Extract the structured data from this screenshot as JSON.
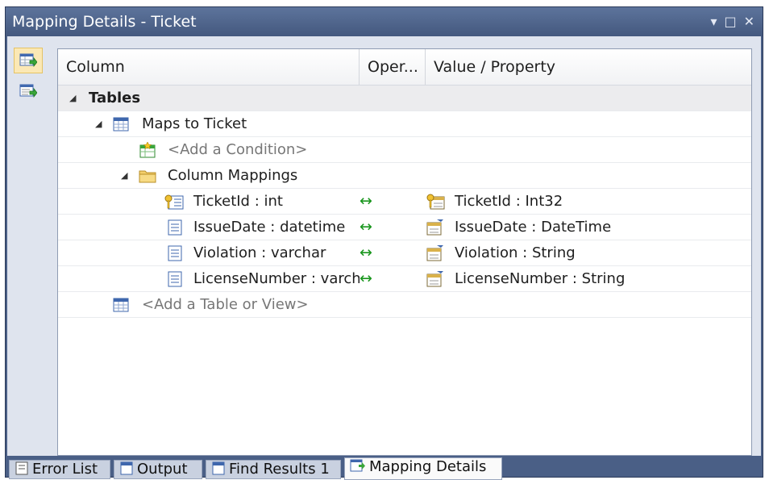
{
  "window": {
    "title": "Mapping Details - Ticket",
    "controls": {
      "dropdown": "▾",
      "maximize": "□",
      "close": "✕"
    }
  },
  "sidebar": {
    "buttons": [
      {
        "icon": "map-to-table-icon",
        "active": true
      },
      {
        "icon": "map-to-function-icon",
        "active": false
      }
    ]
  },
  "grid": {
    "headers": {
      "column": "Column",
      "operator": "Oper...",
      "value": "Value / Property"
    },
    "rows": [
      {
        "label": "Tables"
      },
      {
        "label": "Maps to Ticket"
      },
      {
        "label": "<Add a Condition>"
      },
      {
        "label": "Column Mappings"
      },
      {
        "column": "TicketId : int",
        "op": "↔",
        "property": "TicketId : Int32"
      },
      {
        "column": "IssueDate : datetime",
        "op": "↔",
        "property": "IssueDate : DateTime"
      },
      {
        "column": "Violation : varchar",
        "op": "↔",
        "property": "Violation : String"
      },
      {
        "column": "LicenseNumber : varch",
        "op": "↔",
        "property": "LicenseNumber : String"
      },
      {
        "label": "<Add a Table or View>"
      }
    ]
  },
  "tabs": [
    {
      "label": "Error List",
      "icon": "error-list-icon"
    },
    {
      "label": "Output",
      "icon": "output-icon"
    },
    {
      "label": "Find Results 1",
      "icon": "find-results-icon"
    },
    {
      "label": "Mapping Details",
      "icon": "mapping-details-icon",
      "active": true
    }
  ],
  "colors": {
    "titlebar": "#4a5f86",
    "operator_arrow": "#19961d",
    "placeholder_text": "#777777"
  }
}
